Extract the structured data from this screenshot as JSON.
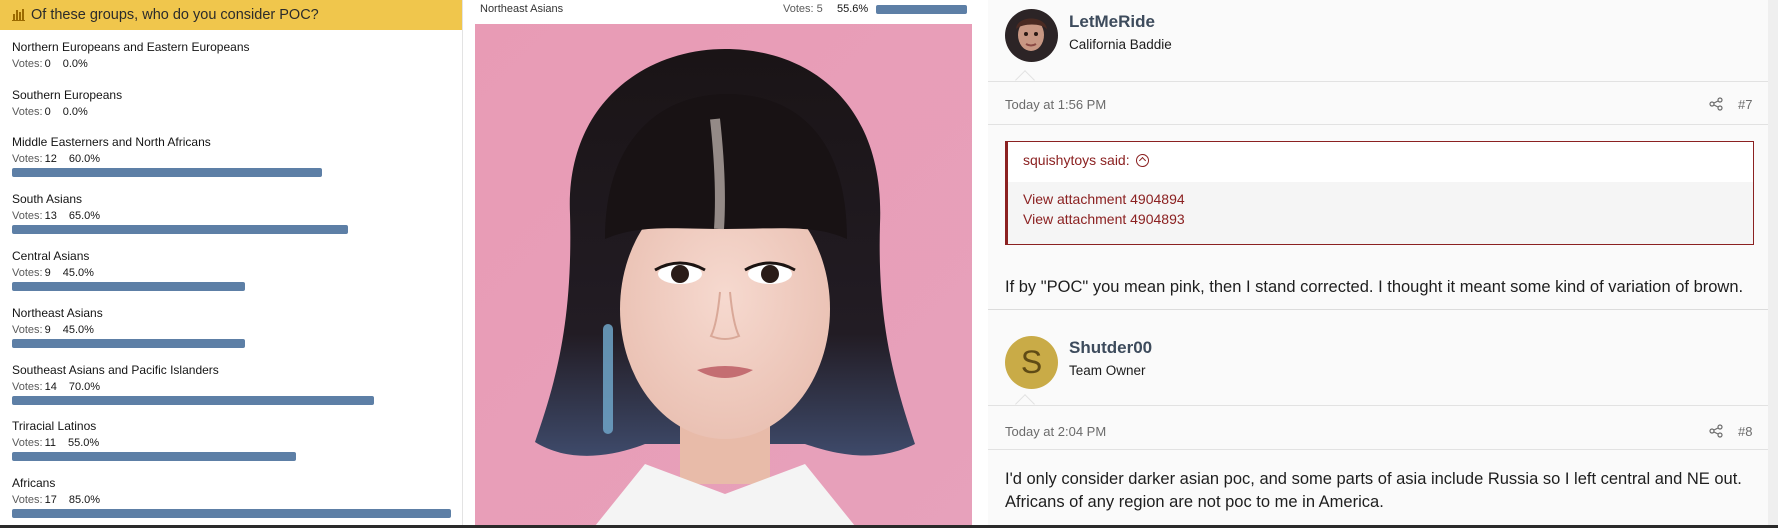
{
  "poll": {
    "question": "Of these groups, who do you consider POC?",
    "votes_prefix": "Votes:",
    "accent_color": "#5d7fa6",
    "header_color": "#f0c64c",
    "options": [
      {
        "label": "Northern Europeans and Eastern Europeans",
        "votes": "0",
        "percent": "0.0%",
        "fraction": 0.0
      },
      {
        "label": "Southern Europeans",
        "votes": "0",
        "percent": "0.0%",
        "fraction": 0.0
      },
      {
        "label": "Middle Easterners and North Africans",
        "votes": "12",
        "percent": "60.0%",
        "fraction": 0.6
      },
      {
        "label": "South Asians",
        "votes": "13",
        "percent": "65.0%",
        "fraction": 0.65
      },
      {
        "label": "Central Asians",
        "votes": "9",
        "percent": "45.0%",
        "fraction": 0.45
      },
      {
        "label": "Northeast Asians",
        "votes": "9",
        "percent": "45.0%",
        "fraction": 0.45
      },
      {
        "label": "Southeast Asians and Pacific Islanders",
        "votes": "14",
        "percent": "70.0%",
        "fraction": 0.7
      },
      {
        "label": "Triracial Latinos",
        "votes": "11",
        "percent": "55.0%",
        "fraction": 0.55
      },
      {
        "label": "Africans",
        "votes": "17",
        "percent": "85.0%",
        "fraction": 0.85
      }
    ]
  },
  "media": {
    "poll_label": "Northeast Asians",
    "votes_label": "Votes: 5",
    "percent": "55.6%",
    "fraction": 0.556,
    "image": "portrait-photo"
  },
  "thread": {
    "posts": [
      {
        "username": "LetMeRide",
        "user_title": "California Baddie",
        "avatar": "user-photo-avatar",
        "time": "Today at 1:56 PM",
        "number": "#7",
        "quote": {
          "author_line": "squishytoys said:",
          "links": [
            "View attachment 4904894",
            "View attachment 4904893"
          ]
        },
        "text": "If by \"POC\" you mean pink, then I stand corrected. I thought it meant some kind of variation of brown."
      },
      {
        "username": "Shutder00",
        "user_title": "Team Owner",
        "avatar_letter": "S",
        "avatar_color": "#c9ab47",
        "time": "Today at 2:04 PM",
        "number": "#8",
        "text_lines": [
          "I'd only consider darker asian poc, and some parts of asia include Russia so I left central and NE out.",
          "Africans of any region are not poc to me in America."
        ]
      }
    ]
  }
}
